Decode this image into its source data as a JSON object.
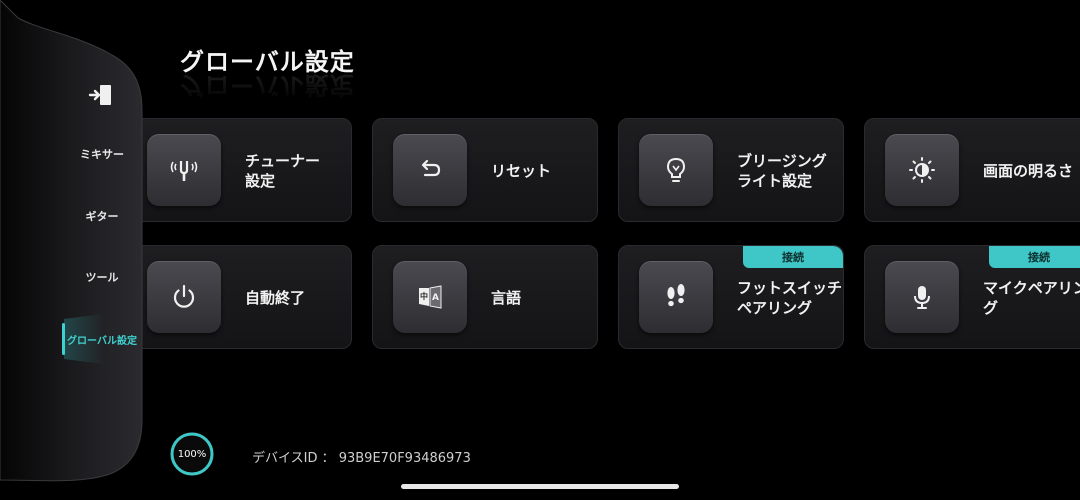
{
  "page": {
    "title": "グローバル設定"
  },
  "sidebar": {
    "items": [
      {
        "label": "ミキサー",
        "active": false
      },
      {
        "label": "ギター",
        "active": false
      },
      {
        "label": "ツール",
        "active": false
      },
      {
        "label": "グローバル設定",
        "active": true
      }
    ],
    "accent_color": "#3fd1cf"
  },
  "cards": [
    {
      "label": "チューナー\n設定",
      "icon": "tuning-fork-icon"
    },
    {
      "label": "リセット",
      "icon": "undo-icon"
    },
    {
      "label": "ブリージング\nライト設定",
      "icon": "light-bulb-icon"
    },
    {
      "label": "画面の明るさ",
      "icon": "brightness-icon"
    },
    {
      "label": "自動終了",
      "icon": "power-icon"
    },
    {
      "label": "言語",
      "icon": "translate-icon"
    },
    {
      "label": "フットスイッチ\nペアリング",
      "icon": "footprints-icon",
      "badge": "接続"
    },
    {
      "label": "マイクペアリン\nグ",
      "icon": "microphone-icon",
      "badge": "接続"
    }
  ],
  "footer": {
    "battery": {
      "text": "100%",
      "level": 100
    },
    "device_id": "デバイスID ： 93B9E70F93486973"
  },
  "colors": {
    "badge": "#3fc6c6",
    "card_bg": "#1a1a1d",
    "background": "#000000"
  }
}
